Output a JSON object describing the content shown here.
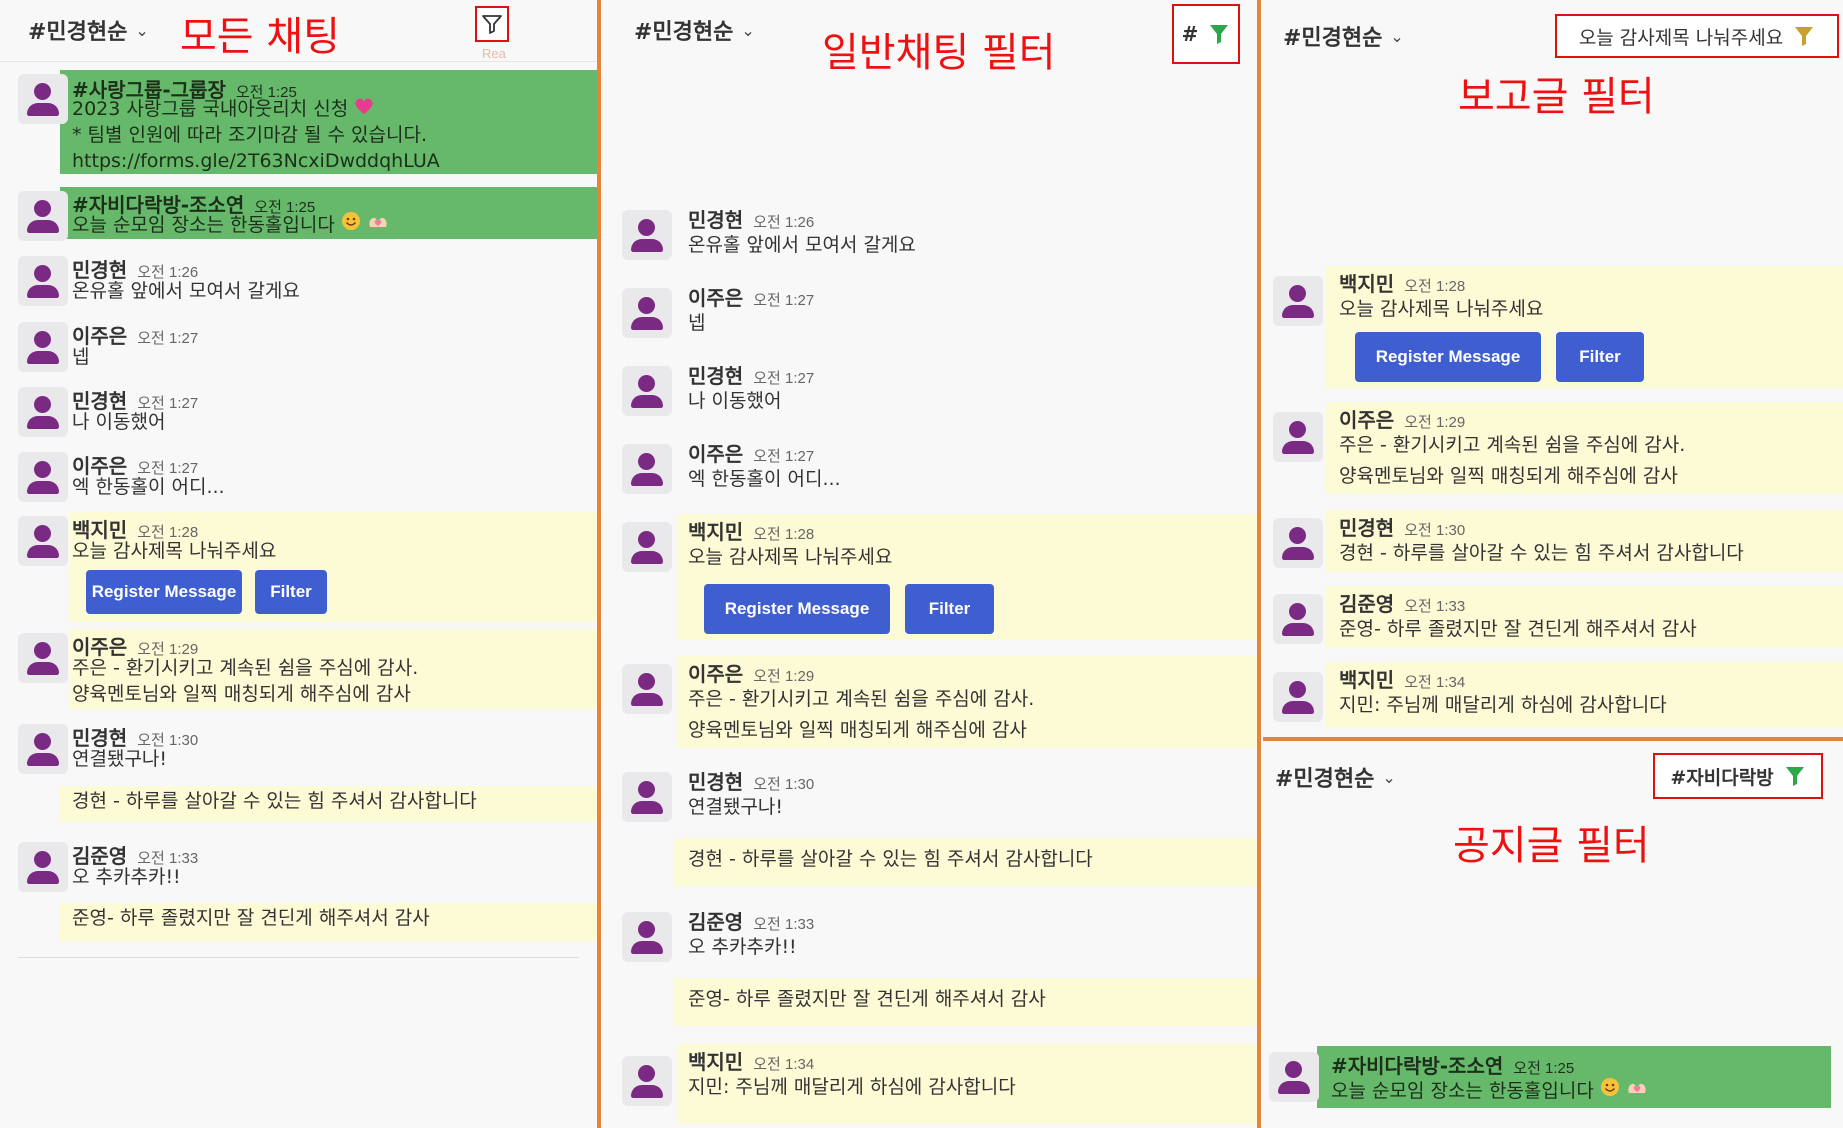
{
  "colors": {
    "annotation_red": "#ee1111",
    "divider_orange": "#e8833a",
    "highlight_green": "#66b96a",
    "highlight_yellow": "#fdfbd6",
    "button_blue": "#3f5fd0",
    "avatar_purple": "#7b2a83",
    "filter_funnel_green": "#2aa84a",
    "filter_funnel_gold": "#c8a030"
  },
  "channel_title": "#민경현순",
  "chevron_icon": "chevron-down-icon",
  "panels": {
    "all_chat": {
      "annotation": "모든 채팅",
      "filter_icon": "funnel-outline-icon"
    },
    "normal_filter": {
      "annotation": "일반채팅 필터",
      "filter_label": "#",
      "filter_icon": "funnel-green-icon"
    },
    "report_filter": {
      "annotation": "보고글 필터",
      "filter_label": "오늘 감사제목 나눠주세요",
      "filter_icon": "funnel-gold-icon"
    },
    "notice_filter": {
      "annotation": "공지글 필터",
      "filter_label": "#자비다락방",
      "filter_icon": "funnel-green-icon"
    }
  },
  "messages": {
    "notice_group": {
      "name": "#사랑그룹-그룹장",
      "time": "오전 1:25",
      "line1": "2023 사랑그룹 국내아웃리치 신청",
      "line2": "* 팀별 인원에 따라 조기마감 될 수 있습니다.",
      "line3": "https://forms.gle/2T63NcxiDwddqhLUA"
    },
    "notice_jabi": {
      "name": "#자비다락방-조소연",
      "time": "오전 1:25",
      "line1": "오늘 순모임 장소는 한동홀입니다"
    },
    "m1": {
      "name": "민경현",
      "time": "오전 1:26",
      "text": "온유홀 앞에서 모여서 갈게요"
    },
    "m2": {
      "name": "이주은",
      "time": "오전 1:27",
      "text": "넵"
    },
    "m3": {
      "name": "민경현",
      "time": "오전 1:27",
      "text": "나 이동했어"
    },
    "m4": {
      "name": "이주은",
      "time": "오전 1:27",
      "text": "엑 한동홀이 어디..."
    },
    "m5": {
      "name": "백지민",
      "time": "오전 1:28",
      "text": "오늘 감사제목 나눠주세요"
    },
    "m6": {
      "name": "이주은",
      "time": "오전 1:29",
      "line1": "주은 - 환기시키고 계속된 쉼을 주심에 감사.",
      "line2": "양육멘토님와 일찍 매칭되게 해주심에 감사"
    },
    "m7": {
      "name": "민경현",
      "time": "오전 1:30",
      "text": "연결됐구나!",
      "reply": "경현 - 하루를 살아갈 수 있는 힘 주셔서 감사합니다"
    },
    "m8": {
      "name": "김준영",
      "time": "오전 1:33",
      "text": "오 추카추카!!",
      "reply": "준영- 하루 졸렸지만 잘 견딘게 해주셔서 감사"
    },
    "m9": {
      "name": "백지민",
      "time": "오전 1:34",
      "text": "지민: 주님께 매달리게 하심에 감사합니다"
    },
    "p3_m7_text": "경현 - 하루를 살아갈 수 있는 힘 주셔서 감사합니다",
    "p3_m8_text": "준영- 하루 졸렸지만 잘 견딘게 해주셔서 감사"
  },
  "buttons": {
    "register": "Register Message",
    "filter": "Filter"
  },
  "icons": {
    "heart": "heart-emoji-icon",
    "smile": "smile-emoji-icon",
    "hands": "heart-hands-emoji-icon",
    "avatar": "user-avatar-icon"
  },
  "partial_text": "Rea"
}
